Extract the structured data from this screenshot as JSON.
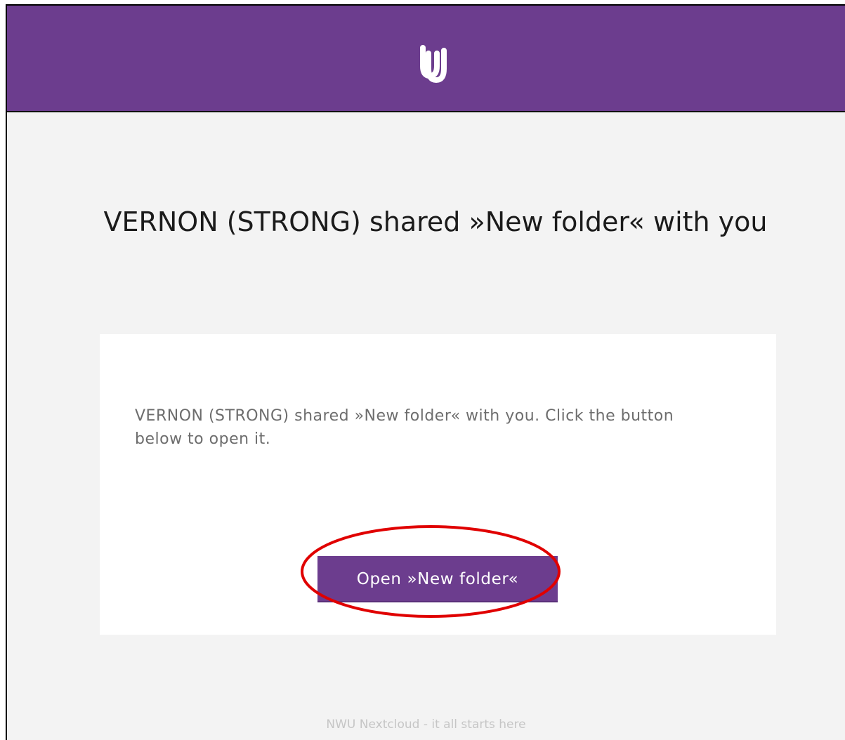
{
  "header": {
    "logo_icon": "nwu-logo-icon",
    "background_color": "#6c3d8e"
  },
  "email": {
    "title": "VERNON (STRONG) shared »New folder« with you",
    "message": "VERNON (STRONG) shared »New folder« with you. Click the button below to open it.",
    "open_button_label": "Open »New folder«",
    "footer": "NWU Nextcloud - it all starts here"
  },
  "annotation": {
    "shape": "ellipse",
    "color": "#e00000",
    "target": "open-button"
  }
}
